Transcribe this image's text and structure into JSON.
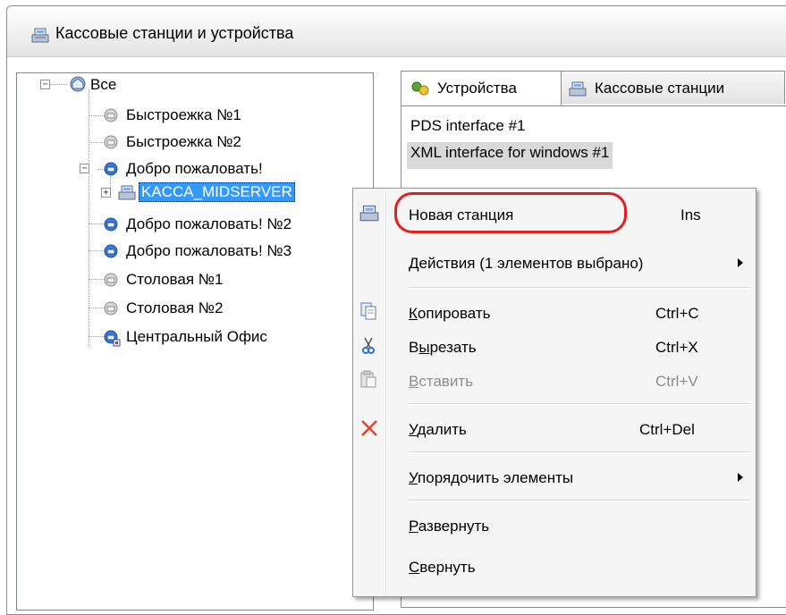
{
  "window": {
    "title": "Кассовые станции и устройства"
  },
  "tree": {
    "root_label": "Все",
    "items": [
      {
        "label": "Быстроежка №1"
      },
      {
        "label": "Быстроежка №2"
      },
      {
        "label": "Добро пожаловать!"
      },
      {
        "label": "KACCA_MIDSERVER"
      },
      {
        "label": "Добро пожаловать! №2"
      },
      {
        "label": "Добро пожаловать! №3"
      },
      {
        "label": "Столовая №1"
      },
      {
        "label": "Столовая №2"
      },
      {
        "label": "Центральный Офис"
      }
    ]
  },
  "tabs": [
    {
      "label": "Устройства"
    },
    {
      "label": "Кассовые станции"
    }
  ],
  "devices": [
    {
      "label": "PDS interface #1"
    },
    {
      "label": "XML interface for windows #1"
    }
  ],
  "context_menu": {
    "new_station": {
      "label": "Новая станция",
      "shortcut": "Ins"
    },
    "actions": {
      "label": "Действия (1 элементов выбрано)"
    },
    "copy": {
      "first": "К",
      "rest": "опировать",
      "shortcut": "Ctrl+C"
    },
    "cut": {
      "pre": "В",
      "u": "ы",
      "rest": "резать",
      "shortcut": "Ctrl+X"
    },
    "paste": {
      "first": "В",
      "rest": "ставить",
      "shortcut": "Ctrl+V"
    },
    "delete": {
      "first": "У",
      "rest": "далить",
      "shortcut": "Ctrl+Del"
    },
    "sort": {
      "first": "У",
      "rest": "порядочить элементы"
    },
    "expand": {
      "first": "Р",
      "rest": "азвернуть"
    },
    "collapse": {
      "first": "С",
      "rest": "вернуть"
    }
  },
  "colors": {
    "selection": "#3399ff",
    "callout": "#e02020"
  }
}
